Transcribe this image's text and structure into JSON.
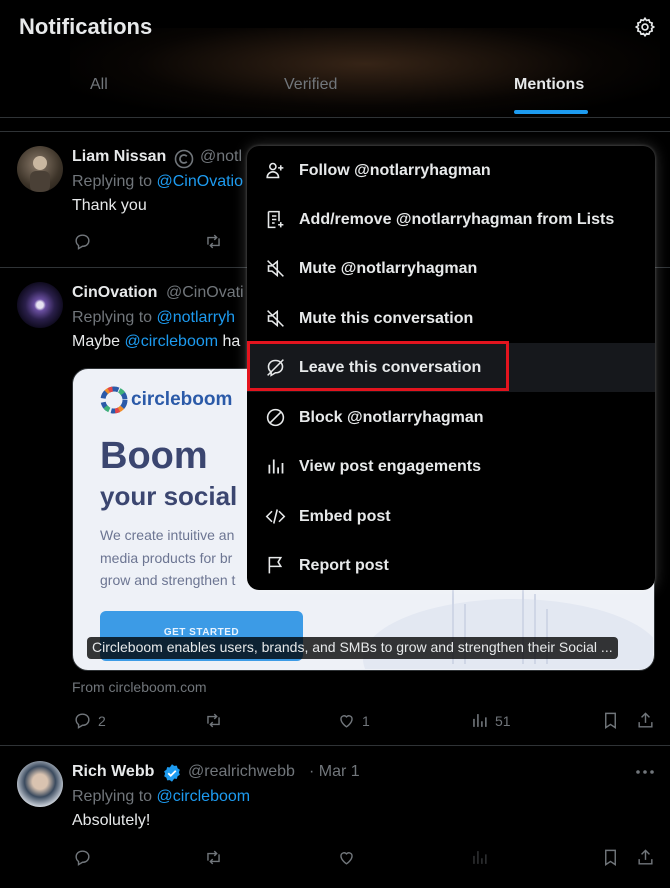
{
  "header": {
    "title": "Notifications",
    "tabs": [
      {
        "label": "All"
      },
      {
        "label": "Verified"
      },
      {
        "label": "Mentions"
      }
    ]
  },
  "posts": [
    {
      "name": "Liam Nissan",
      "handle": "@notl",
      "replying_prefix": "Replying to ",
      "replying_to": "@CinOvatio",
      "text": "Thank you"
    },
    {
      "name": "CinOvation",
      "handle": "@CinOvati",
      "replying_prefix": "Replying to ",
      "replying_to": "@notlarryh",
      "text_prefix": "Maybe ",
      "text_mention": "@circleboom",
      "text_suffix": " ha",
      "card": {
        "logo_text": "circleboom",
        "headline": "Boom",
        "subheadline": "your social",
        "lines": [
          "We create intuitive an",
          "media products for br",
          "grow and strengthen t"
        ],
        "button": "GET STARTED",
        "caption": "Circleboom enables users, brands, and SMBs to grow and strengthen their Social ...",
        "source": "From circleboom.com"
      },
      "stats": {
        "replies": "2",
        "likes": "1",
        "views": "51"
      }
    },
    {
      "name": "Rich Webb",
      "handle": "@realrichwebb",
      "date": "· Mar 1",
      "replying_prefix": "Replying to ",
      "replying_to": "@circleboom",
      "text": "Absolutely!"
    }
  ],
  "menu": {
    "items": [
      {
        "label": "Follow @notlarryhagman",
        "icon": "follow-icon"
      },
      {
        "label": "Add/remove @notlarryhagman from Lists",
        "icon": "list-icon"
      },
      {
        "label": "Mute @notlarryhagman",
        "icon": "mute-icon"
      },
      {
        "label": "Mute this conversation",
        "icon": "mute-icon"
      },
      {
        "label": "Leave this conversation",
        "icon": "leave-icon"
      },
      {
        "label": "Block @notlarryhagman",
        "icon": "block-icon"
      },
      {
        "label": "View post engagements",
        "icon": "engagements-icon"
      },
      {
        "label": "Embed post",
        "icon": "code-icon"
      },
      {
        "label": "Report post",
        "icon": "flag-icon"
      }
    ]
  },
  "colors": {
    "accent": "#1d9bf0",
    "highlight": "#e3141e",
    "verified": "#1d9bf0"
  }
}
